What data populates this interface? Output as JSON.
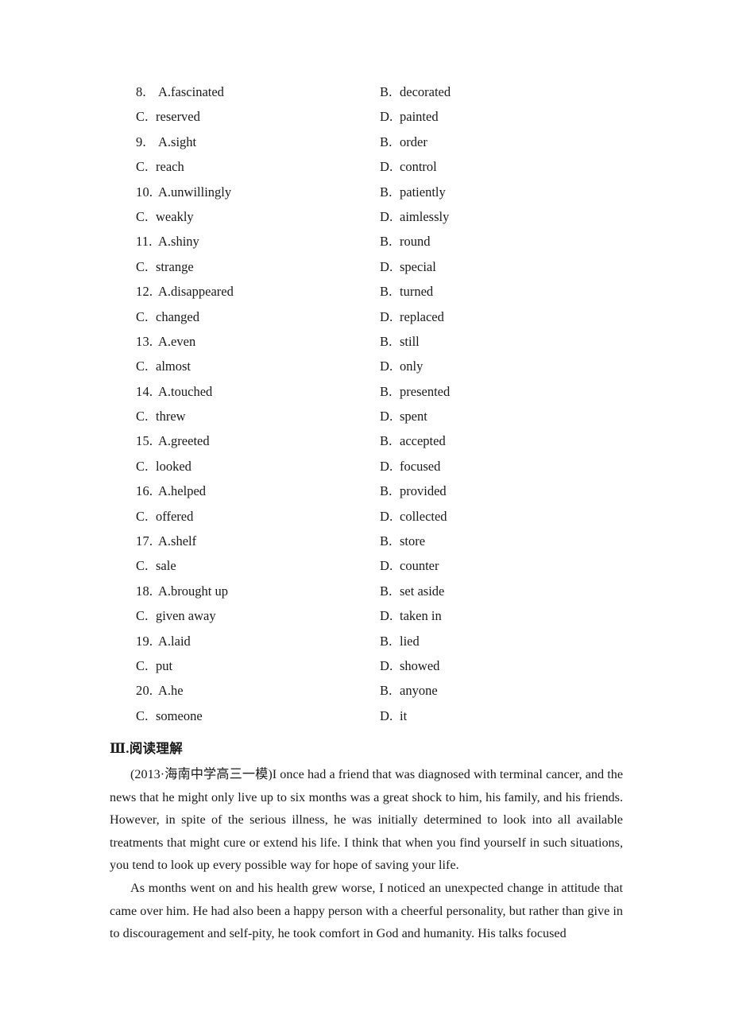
{
  "cloze": {
    "items": [
      {
        "num": "8.",
        "a_label": "A.",
        "a_text": "fascinated",
        "b_label": "B.",
        "b_text": "decorated",
        "c_label": "C.",
        "c_text": "reserved",
        "d_label": "D.",
        "d_text": "painted"
      },
      {
        "num": "9.",
        "a_label": "A.",
        "a_text": "sight",
        "b_label": "B.",
        "b_text": "order",
        "c_label": "C.",
        "c_text": "reach",
        "d_label": "D.",
        "d_text": "control"
      },
      {
        "num": "10.",
        "a_label": "A.",
        "a_text": "unwillingly",
        "b_label": "B.",
        "b_text": "patiently",
        "c_label": "C.",
        "c_text": "weakly",
        "d_label": "D.",
        "d_text": "aimlessly"
      },
      {
        "num": "11.",
        "a_label": "A.",
        "a_text": "shiny",
        "b_label": "B.",
        "b_text": "round",
        "c_label": "C.",
        "c_text": "strange",
        "d_label": "D.",
        "d_text": "special"
      },
      {
        "num": "12.",
        "a_label": "A.",
        "a_text": "disappeared",
        "b_label": "B.",
        "b_text": "turned",
        "c_label": "C.",
        "c_text": "changed",
        "d_label": "D.",
        "d_text": "replaced"
      },
      {
        "num": "13.",
        "a_label": "A.",
        "a_text": "even",
        "b_label": "B.",
        "b_text": "still",
        "c_label": "C.",
        "c_text": "almost",
        "d_label": "D.",
        "d_text": "only"
      },
      {
        "num": "14.",
        "a_label": "A.",
        "a_text": "touched",
        "b_label": "B.",
        "b_text": "presented",
        "c_label": "C.",
        "c_text": "threw",
        "d_label": "D.",
        "d_text": "spent"
      },
      {
        "num": "15.",
        "a_label": "A.",
        "a_text": "greeted",
        "b_label": "B.",
        "b_text": "accepted",
        "c_label": "C.",
        "c_text": "looked",
        "d_label": "D.",
        "d_text": "focused"
      },
      {
        "num": "16.",
        "a_label": "A.",
        "a_text": "helped",
        "b_label": "B.",
        "b_text": "provided",
        "c_label": "C.",
        "c_text": "offered",
        "d_label": "D.",
        "d_text": "collected"
      },
      {
        "num": "17.",
        "a_label": "A.",
        "a_text": "shelf",
        "b_label": "B.",
        "b_text": "store",
        "c_label": "C.",
        "c_text": "sale",
        "d_label": "D.",
        "d_text": "counter"
      },
      {
        "num": "18.",
        "a_label": "A.",
        "a_text": "brought up",
        "b_label": "B.",
        "b_text": "set aside",
        "c_label": "C.",
        "c_text": "given away",
        "d_label": "D.",
        "d_text": "taken in"
      },
      {
        "num": "19.",
        "a_label": "A.",
        "a_text": "laid",
        "b_label": "B.",
        "b_text": "lied",
        "c_label": "C.",
        "c_text": "put",
        "d_label": "D.",
        "d_text": "showed"
      },
      {
        "num": "20.",
        "a_label": "A.",
        "a_text": "he",
        "b_label": "B.",
        "b_text": "anyone",
        "c_label": "C.",
        "c_text": "someone",
        "d_label": "D.",
        "d_text": "it"
      }
    ]
  },
  "section": {
    "heading": "Ⅲ.阅读理解"
  },
  "passage": {
    "source": "(2013·海南中学高三一模)",
    "paragraph1_rest": "I once had a friend that was diagnosed with terminal cancer, and the news that he might only live up to six months was a great shock to him, his family, and his friends. However, in spite of the serious illness, he was initially determined to look into all available treatments that might cure or extend his life. I think that when you find yourself in such situations, you tend to look up every possible way for hope of saving your life.",
    "paragraph2": "As months went on and his health grew worse, I noticed an unexpected change in attitude that came over him. He had also been a happy person with a cheerful personality, but rather than give in to discouragement and self-pity, he took comfort in God and humanity. His talks focused"
  }
}
